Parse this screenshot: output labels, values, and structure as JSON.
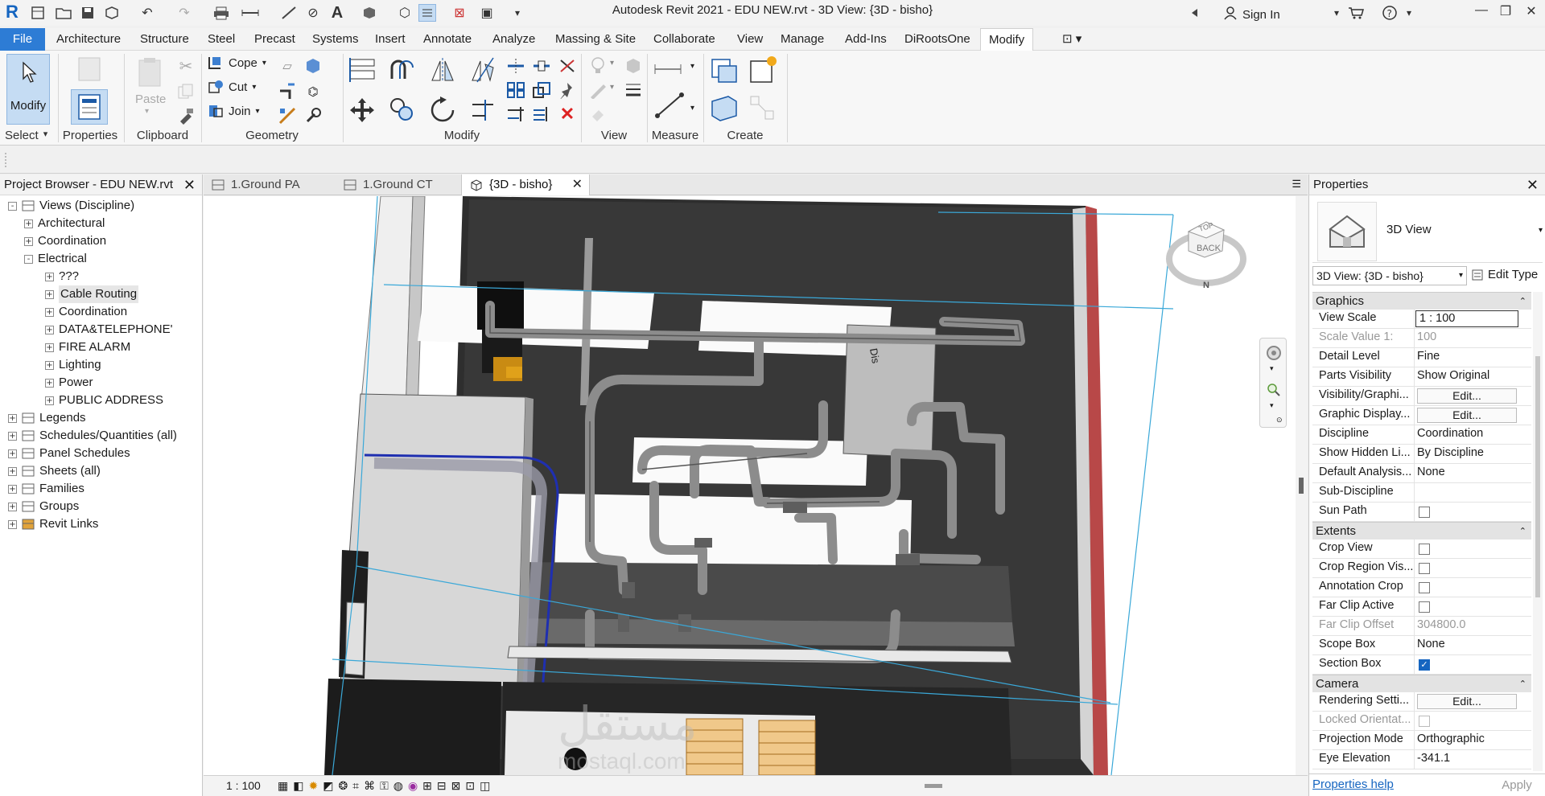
{
  "titlebar": {
    "title": "Autodesk Revit 2021 - EDU NEW.rvt - 3D View: {3D - bisho}",
    "signin": "Sign In",
    "app_letter": "R"
  },
  "menu": {
    "file": "File",
    "tabs": [
      "Architecture",
      "Structure",
      "Steel",
      "Precast",
      "Systems",
      "Insert",
      "Annotate",
      "Analyze",
      "Massing & Site",
      "Collaborate",
      "View",
      "Manage",
      "Add-Ins",
      "DiRootsOne",
      "Modify"
    ]
  },
  "ribbon": {
    "modify_label": "Modify",
    "select_label": "Select",
    "properties_label": "Properties",
    "clipboard_label": "Clipboard",
    "paste_label": "Paste",
    "cope_label": "Cope",
    "cut_label": "Cut",
    "join_label": "Join",
    "geometry_label": "Geometry",
    "modify_group_label": "Modify",
    "view_label": "View",
    "measure_label": "Measure",
    "create_label": "Create"
  },
  "browser": {
    "title": "Project Browser - EDU NEW.rvt",
    "items": [
      {
        "label": "Views (Discipline)",
        "level": 0,
        "toggle": "-"
      },
      {
        "label": "Architectural",
        "level": 1,
        "toggle": "+"
      },
      {
        "label": "Coordination",
        "level": 1,
        "toggle": "+"
      },
      {
        "label": "Electrical",
        "level": 1,
        "toggle": "-"
      },
      {
        "label": "???",
        "level": 2,
        "toggle": "+"
      },
      {
        "label": "Cable Routing",
        "level": 2,
        "toggle": "+"
      },
      {
        "label": "Coordination",
        "level": 2,
        "toggle": "+"
      },
      {
        "label": "DATA&TELEPHONE'",
        "level": 2,
        "toggle": "+"
      },
      {
        "label": "FIRE ALARM",
        "level": 2,
        "toggle": "+"
      },
      {
        "label": "Lighting",
        "level": 2,
        "toggle": "+"
      },
      {
        "label": "Power",
        "level": 2,
        "toggle": "+"
      },
      {
        "label": "PUBLIC ADDRESS",
        "level": 2,
        "toggle": "+"
      },
      {
        "label": "Legends",
        "level": 0,
        "toggle": "+"
      },
      {
        "label": "Schedules/Quantities (all)",
        "level": 0,
        "toggle": "+"
      },
      {
        "label": "Panel Schedules",
        "level": 0,
        "toggle": "+"
      },
      {
        "label": "Sheets (all)",
        "level": 0,
        "toggle": "+"
      },
      {
        "label": "Families",
        "level": 0,
        "toggle": "+"
      },
      {
        "label": "Groups",
        "level": 0,
        "toggle": "+"
      },
      {
        "label": "Revit Links",
        "level": 0,
        "toggle": "+"
      }
    ]
  },
  "viewtabs": {
    "tab1": "1.Ground PA",
    "tab2": "1.Ground CT",
    "tab3": "{3D - bisho}"
  },
  "viewcube": {
    "top": "TOP",
    "back": "BACK",
    "north": "N"
  },
  "viewport": {
    "watermark": "mostaql.com",
    "watermark_arabic": "مستقل",
    "label_tag": "Dis"
  },
  "viewbar": {
    "scale": "1 : 100"
  },
  "properties": {
    "title": "Properties",
    "type_name": "3D View",
    "view_select": "3D View: {3D - bisho}",
    "edit_type": "Edit Type",
    "groups": {
      "graphics": "Graphics",
      "extents": "Extents",
      "camera": "Camera"
    },
    "rows": {
      "view_scale": {
        "name": "View Scale",
        "value": "1 : 100"
      },
      "scale_value": {
        "name": "Scale Value    1:",
        "value": "100"
      },
      "detail_level": {
        "name": "Detail Level",
        "value": "Fine"
      },
      "parts_visibility": {
        "name": "Parts Visibility",
        "value": "Show Original"
      },
      "visibility_graphics": {
        "name": "Visibility/Graphi...",
        "value": "Edit..."
      },
      "graphic_display": {
        "name": "Graphic Display...",
        "value": "Edit..."
      },
      "discipline": {
        "name": "Discipline",
        "value": "Coordination"
      },
      "show_hidden": {
        "name": "Show Hidden Li...",
        "value": "By Discipline"
      },
      "default_analysis": {
        "name": "Default Analysis...",
        "value": "None"
      },
      "sub_discipline": {
        "name": "Sub-Discipline",
        "value": ""
      },
      "sun_path": {
        "name": "Sun Path",
        "checked": false
      },
      "crop_view": {
        "name": "Crop View",
        "checked": false
      },
      "crop_region": {
        "name": "Crop Region Vis...",
        "checked": false
      },
      "annotation_crop": {
        "name": "Annotation Crop",
        "checked": false
      },
      "far_clip_active": {
        "name": "Far Clip Active",
        "checked": false
      },
      "far_clip_offset": {
        "name": "Far Clip Offset",
        "value": "304800.0"
      },
      "scope_box": {
        "name": "Scope Box",
        "value": "None"
      },
      "section_box": {
        "name": "Section Box",
        "checked": true
      },
      "rendering": {
        "name": "Rendering Setti...",
        "value": "Edit..."
      },
      "locked_orient": {
        "name": "Locked Orientat...",
        "checked": false
      },
      "projection": {
        "name": "Projection Mode",
        "value": "Orthographic"
      },
      "eye_elevation": {
        "name": "Eye Elevation",
        "value": "-341.1"
      }
    },
    "help": "Properties help",
    "apply": "Apply"
  },
  "colors": {
    "accent": "#2d7cd5",
    "section_box": "#3aa8d8",
    "pipe": "#8c8c8c"
  }
}
